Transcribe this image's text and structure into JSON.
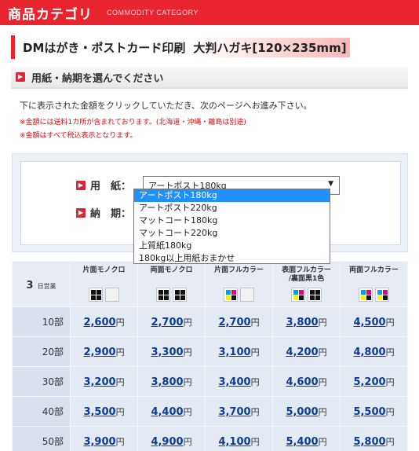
{
  "category": {
    "title": "商品カテゴリ",
    "subtitle": "COMMODITY CATEGORY"
  },
  "heading": {
    "main": "DMはがき・ポストカード印刷",
    "size": "大判ハガキ[120×235mm]"
  },
  "section": {
    "title": "用紙・納期を選んでください"
  },
  "notes": {
    "main": "下に表示された金額をクリックしていただき、次のページへお進み下さい。",
    "red1": "※金額には送料1カ所が含まれております。(北海道・沖縄・離島は別途)",
    "red2": "※金額はすべて税込表示となります。"
  },
  "form": {
    "paper_label": "用　紙：",
    "period_label": "納　期：",
    "selected": "アートポスト180kg",
    "options": [
      "アートポスト180kg",
      "アートポスト220kg",
      "マットコート180kg",
      "マットコート220kg",
      "上質紙180kg",
      "180kg以上用紙おまかせ"
    ]
  },
  "table": {
    "days": "3",
    "days_label": "日営業",
    "yen": "円",
    "columns": [
      "片面モノクロ",
      "両面モノクロ",
      "片面フルカラー",
      "表面フルカラー\n/裏面黒1色",
      "両面フルカラー"
    ],
    "rows": [
      {
        "qty": "10部",
        "prices": [
          "2,600",
          "2,700",
          "2,700",
          "3,800",
          "4,500"
        ]
      },
      {
        "qty": "20部",
        "prices": [
          "2,900",
          "3,300",
          "3,100",
          "4,200",
          "4,800"
        ]
      },
      {
        "qty": "30部",
        "prices": [
          "3,200",
          "3,800",
          "3,400",
          "4,600",
          "5,200"
        ]
      },
      {
        "qty": "40部",
        "prices": [
          "3,500",
          "4,400",
          "3,700",
          "5,000",
          "5,500"
        ]
      },
      {
        "qty": "50部",
        "prices": [
          "3,900",
          "4,900",
          "4,100",
          "5,400",
          "5,800"
        ]
      }
    ]
  },
  "colors": {
    "accent": "#e8252f",
    "link": "#0a3b9a",
    "highlight": "#1e90ff"
  }
}
